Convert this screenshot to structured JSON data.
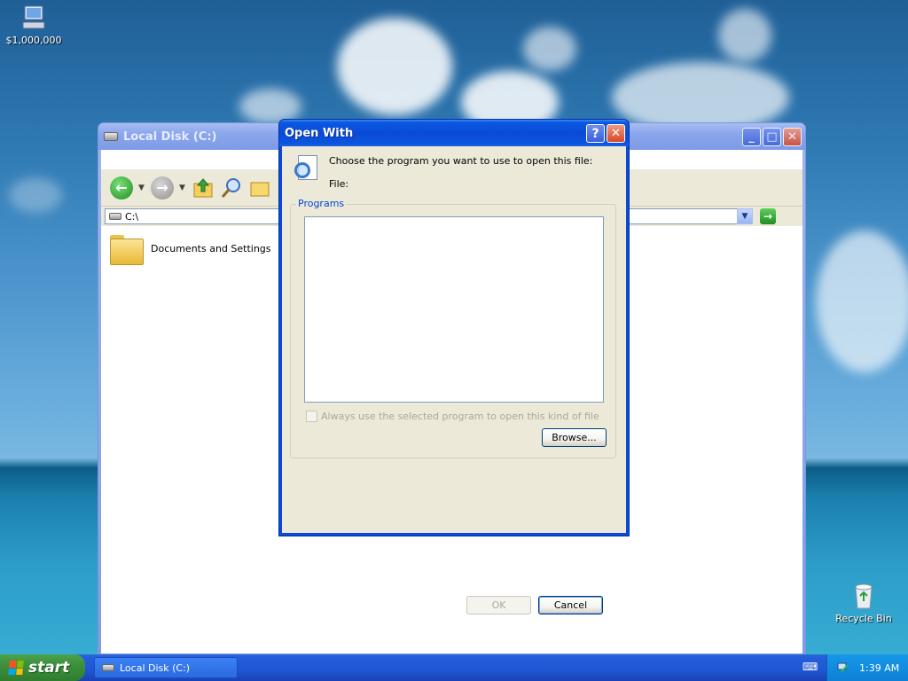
{
  "desktop": {
    "icons": [
      {
        "label": "$1,000,000",
        "icon": "my-computer-icon"
      },
      {
        "label": "Recycle Bin",
        "icon": "recycle-bin-icon"
      }
    ]
  },
  "explorer": {
    "title": "Local Disk (C:)",
    "address": "C:\\",
    "items": [
      {
        "label": "Documents and Settings",
        "icon": "folder-icon"
      }
    ]
  },
  "dialog": {
    "title": "Open With",
    "prompt": "Choose the program you want to use to open this file:",
    "file_label": "File:",
    "programs_legend": "Programs",
    "always_label": "Always use the selected program to open this kind of file",
    "browse_label": "Browse...",
    "ok_label": "OK",
    "cancel_label": "Cancel",
    "help_glyph": "?",
    "close_glyph": "✕"
  },
  "taskbar": {
    "start_label": "start",
    "task_label": "Local Disk (C:)",
    "clock": "1:39 AM"
  },
  "colors": {
    "title_active": "#0a4ad6",
    "group_legend": "#0046d5",
    "taskbar": "#245edb",
    "start_green": "#3c8f3c"
  }
}
